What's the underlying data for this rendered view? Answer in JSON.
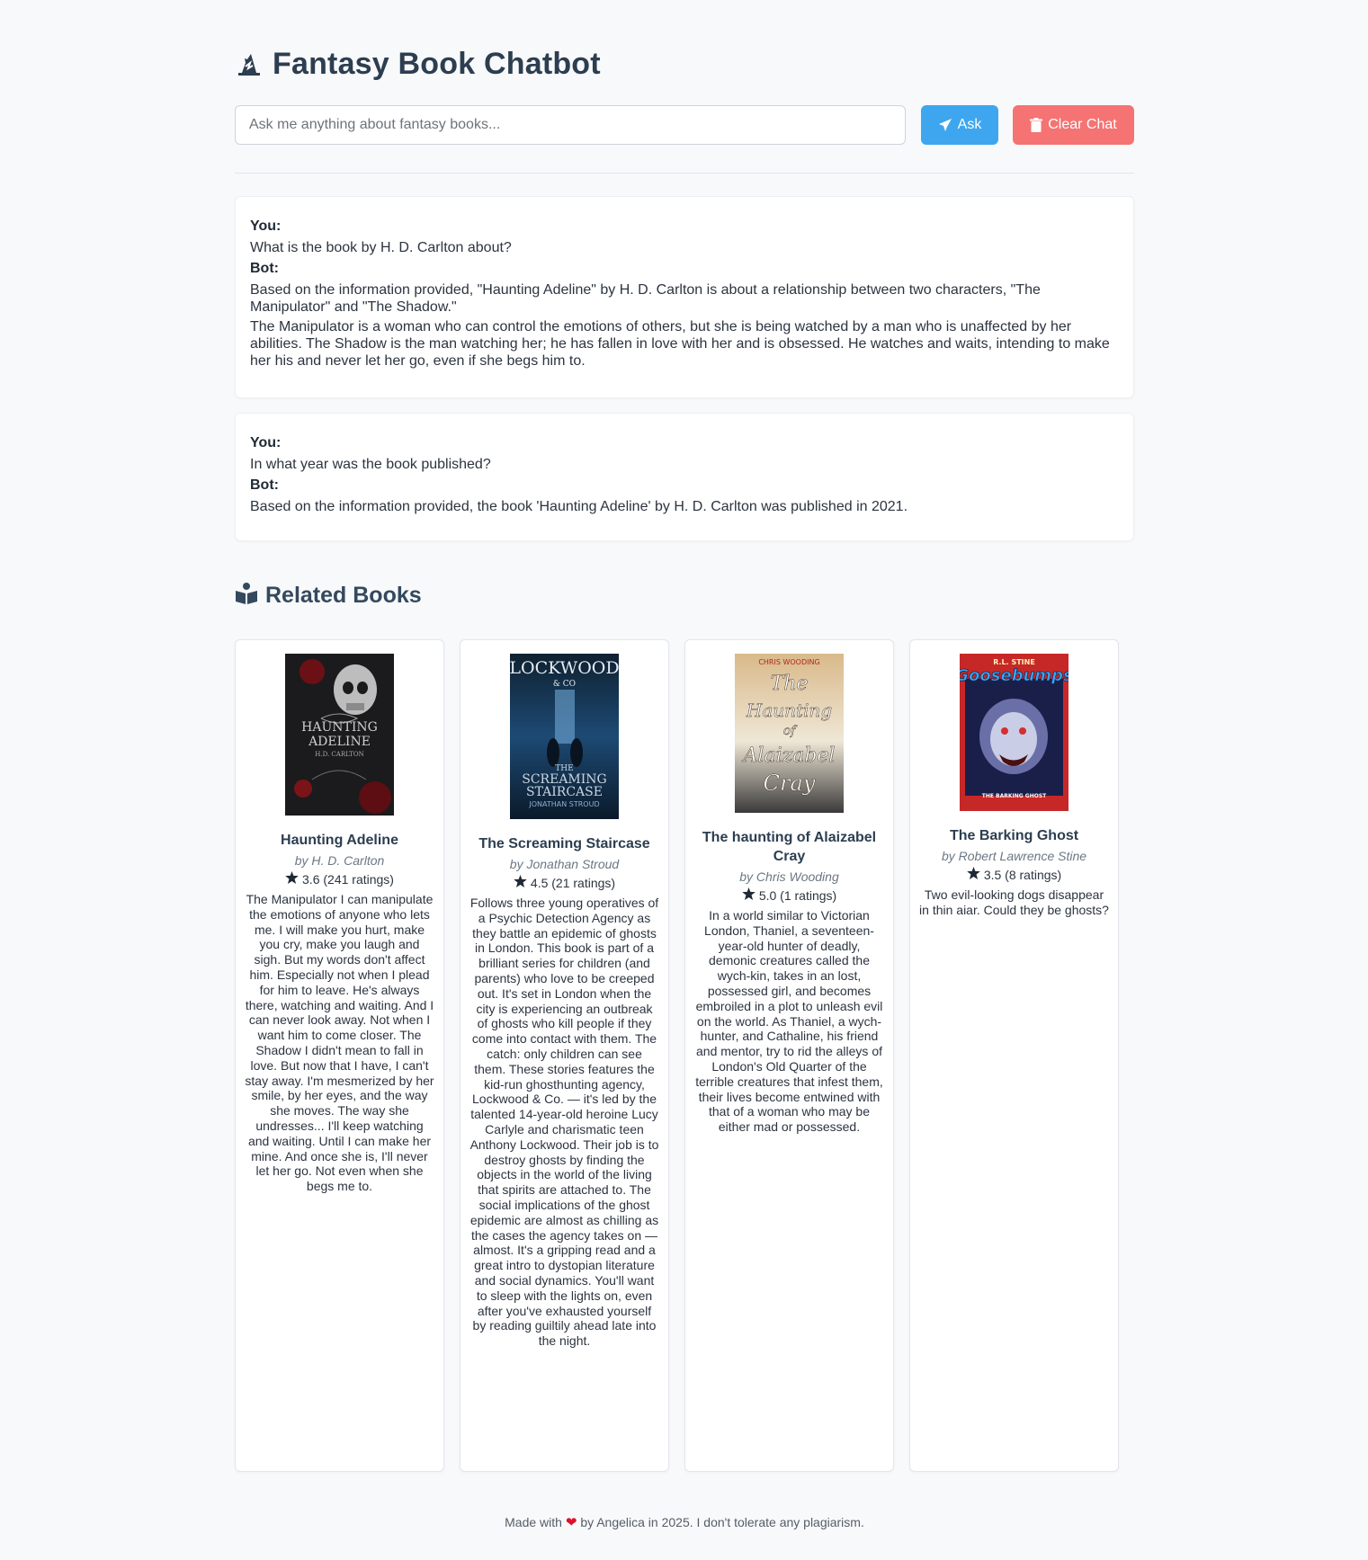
{
  "header": {
    "title": "Fantasy Book Chatbot",
    "icon": "wizard-hat-icon"
  },
  "ask": {
    "placeholder": "Ask me anything about fantasy books...",
    "value": "",
    "ask_label": "Ask",
    "clear_label": "Clear Chat"
  },
  "chat": [
    {
      "you_label": "You:",
      "question": "What is the book by H. D. Carlton about?",
      "bot_label": "Bot:",
      "answer": [
        "Based on the information provided, \"Haunting Adeline\" by H. D. Carlton is about a relationship between two characters, \"The Manipulator\" and \"The Shadow.\"",
        "The Manipulator is a woman who can control the emotions of others, but she is being watched by a man who is unaffected by her abilities. The Shadow is the man watching her; he has fallen in love with her and is obsessed. He watches and waits, intending to make her his and never let her go, even if she begs him to."
      ]
    },
    {
      "you_label": "You:",
      "question": "In what year was the book published?",
      "bot_label": "Bot:",
      "answer": [
        "Based on the information provided, the book 'Haunting Adeline' by H. D. Carlton was published in 2021."
      ]
    }
  ],
  "related": {
    "heading": "Related Books",
    "icon": "open-book-reader-icon",
    "books": [
      {
        "title": "Haunting Adeline",
        "author": "by H. D. Carlton",
        "rating": "3.6 (241 ratings)",
        "description": "The Manipulator I can manipulate the emotions of anyone who lets me. I will make you hurt, make you cry, make you laugh and sigh. But my words don't affect him. Especially not when I plead for him to leave. He's always there, watching and waiting. And I can never look away. Not when I want him to come closer. The Shadow I didn't mean to fall in love. But now that I have, I can't stay away. I'm mesmerized by her smile, by her eyes, and the way she moves. The way she undresses... I'll keep watching and waiting. Until I can make her mine. And once she is, I'll never let her go. Not even when she begs me to.",
        "cover_lines": [
          "HAUNTING",
          "ADELINE",
          "H.D. CARLTON"
        ]
      },
      {
        "title": "The Screaming Staircase",
        "author": "by Jonathan Stroud",
        "rating": "4.5 (21 ratings)",
        "description": "Follows three young operatives of a Psychic Detection Agency as they battle an epidemic of ghosts in London. This book is part of a brilliant series for children (and parents) who love to be creeped out. It's set in London when the city is experiencing an outbreak of ghosts who kill people if they come into contact with them. The catch: only children can see them. These stories features the kid-run ghosthunting agency, Lockwood & Co. — it's led by the talented 14-year-old heroine Lucy Carlyle and charismatic teen Anthony Lockwood. Their job is to destroy ghosts by finding the objects in the world of the living that spirits are attached to. The social implications of the ghost epidemic are almost as chilling as the cases the agency takes on — almost. It's a gripping read and a great intro to dystopian literature and social dynamics. You'll want to sleep with the lights on, even after you've exhausted yourself by reading guiltily ahead late into the night.",
        "cover_lines": [
          "LOCKWOOD",
          "& CO",
          "THE",
          "SCREAMING",
          "STAIRCASE",
          "JONATHAN STROUD"
        ]
      },
      {
        "title": "The haunting of Alaizabel Cray",
        "author": "by Chris Wooding",
        "rating": "5.0 (1 ratings)",
        "description": "In a world similar to Victorian London, Thaniel, a seventeen-year-old hunter of deadly, demonic creatures called the wych-kin, takes in an lost, possessed girl, and becomes embroiled in a plot to unleash evil on the world. As Thaniel, a wych-hunter, and Cathaline, his friend and mentor, try to rid the alleys of London's Old Quarter of the terrible creatures that infest them, their lives become entwined with that of a woman who may be either mad or possessed.",
        "cover_lines": [
          "CHRIS WOODING",
          "The",
          "Haunting",
          "of",
          "Alaizabel",
          "Cray"
        ]
      },
      {
        "title": "The Barking Ghost",
        "author": "by Robert Lawrence Stine",
        "rating": "3.5 (8 ratings)",
        "description": "Two evil-looking dogs disappear in thin aiar. Could they be ghosts?",
        "cover_lines": [
          "R.L. STINE",
          "Goosebumps",
          "THE BARKING GHOST"
        ]
      }
    ]
  },
  "footer": {
    "before": "Made with",
    "after": "by Angelica in 2025. I don't tolerate any plagiarism."
  },
  "colors": {
    "ask_button": "#3ea6ef",
    "clear_button": "#f57373",
    "heart": "#e0112b",
    "background": "#f8f9fb"
  }
}
